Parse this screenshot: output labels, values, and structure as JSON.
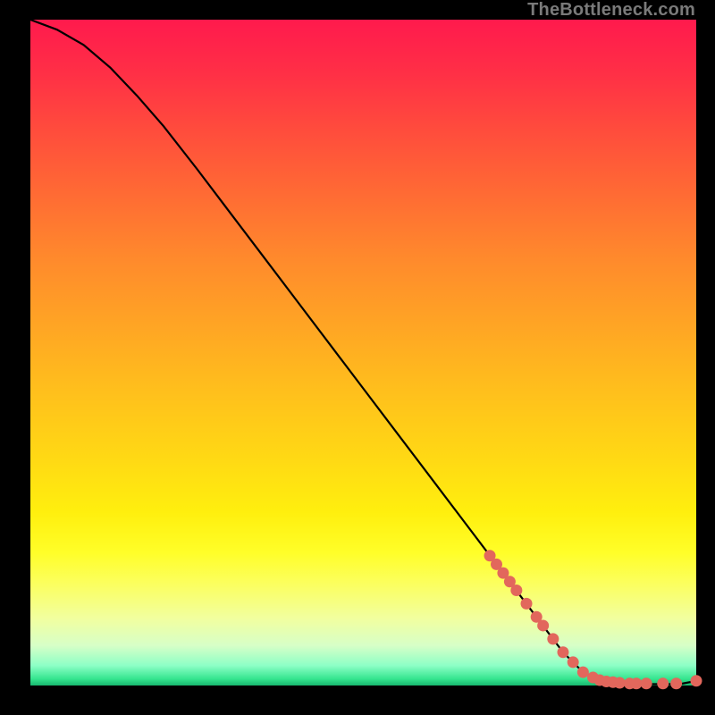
{
  "watermark": "TheBottleneck.com",
  "chart_data": {
    "type": "line",
    "title": "",
    "xlabel": "",
    "ylabel": "",
    "xlim": [
      0,
      100
    ],
    "ylim": [
      0,
      100
    ],
    "series": [
      {
        "name": "curve",
        "x": [
          0,
          4,
          8,
          12,
          16,
          20,
          25,
          30,
          35,
          40,
          45,
          50,
          55,
          60,
          65,
          70,
          75,
          80,
          83,
          86,
          88,
          90,
          92,
          94,
          96,
          98,
          100
        ],
        "y": [
          100,
          98.5,
          96.2,
          92.8,
          88.6,
          84.0,
          77.6,
          71.0,
          64.4,
          57.8,
          51.2,
          44.6,
          38.0,
          31.4,
          24.8,
          18.2,
          11.6,
          5.0,
          2.0,
          0.6,
          0.3,
          0.2,
          0.2,
          0.2,
          0.2,
          0.3,
          0.7
        ]
      }
    ],
    "markers": {
      "name": "highlighted-points",
      "color": "#e2675c",
      "x": [
        69,
        70,
        71,
        72,
        73,
        74.5,
        76,
        77,
        78.5,
        80,
        81.5,
        83,
        84.5,
        85.5,
        86.5,
        87.5,
        88.5,
        90,
        91,
        92.5,
        95,
        97,
        100
      ],
      "y": [
        19.5,
        18.2,
        16.9,
        15.6,
        14.3,
        12.3,
        10.3,
        9.0,
        7.0,
        5.0,
        3.5,
        2.0,
        1.2,
        0.8,
        0.6,
        0.5,
        0.4,
        0.3,
        0.3,
        0.3,
        0.3,
        0.3,
        0.7
      ]
    }
  }
}
